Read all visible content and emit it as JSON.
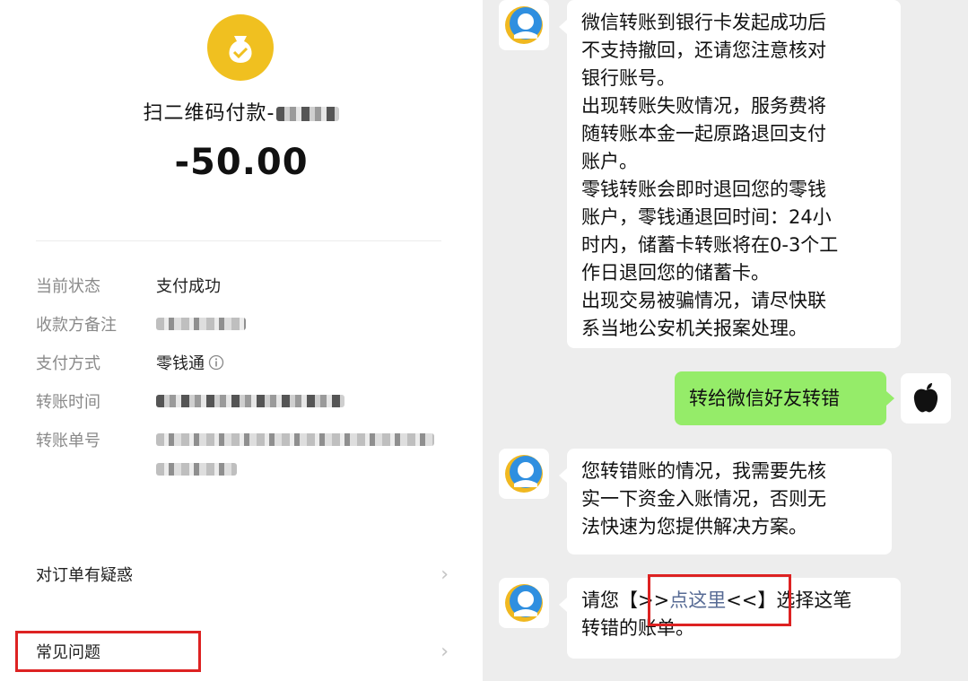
{
  "payment": {
    "title": "扫二维码付款-",
    "amount": "-50.00",
    "details": [
      {
        "label": "当前状态",
        "value": "支付成功"
      },
      {
        "label": "收款方备注",
        "value": ""
      },
      {
        "label": "支付方式",
        "value": "零钱通"
      },
      {
        "label": "转账时间",
        "value": ""
      },
      {
        "label": "转账单号",
        "value": ""
      }
    ],
    "menu": [
      {
        "label": "对订单有疑惑"
      },
      {
        "label": "常见问题"
      }
    ]
  },
  "chat": {
    "messages": [
      {
        "from": "bot",
        "lines": [
          "微信转账到银行卡发起成功后",
          "不支持撤回，还请您注意核对",
          "银行账号。",
          "出现转账失败情况，服务费将",
          "随转账本金一起原路退回支付",
          "账户。",
          "零钱转账会即时退回您的零钱",
          "账户，零钱通退回时间：24小",
          "时内，储蓄卡转账将在0-3个工",
          "作日退回您的储蓄卡。",
          "出现交易被骗情况，请尽快联",
          "系当地公安机关报案处理。"
        ]
      },
      {
        "from": "user",
        "text": "转给微信好友转错"
      },
      {
        "from": "bot",
        "lines": [
          "您转错账的情况，我需要先核",
          "实一下资金入账情况，否则无",
          "法快速为您提供解决方案。"
        ]
      },
      {
        "from": "bot",
        "prefix": "请您【",
        "link_open": ">>",
        "link": "点这里",
        "link_close": "<<",
        "suffix": "】选择这笔",
        "line2": "转错的账单。"
      }
    ]
  },
  "icons": {
    "payee": "money-bag-icon",
    "info": "info-icon",
    "chevron": "chevron-right-icon",
    "bot_avatar": "service-agent-icon",
    "user_avatar": "apple-avatar-icon"
  },
  "colors": {
    "highlight": "#dd2222",
    "accent_gold": "#f0c020",
    "bubble_green": "#95ec69",
    "link": "#576b95"
  }
}
